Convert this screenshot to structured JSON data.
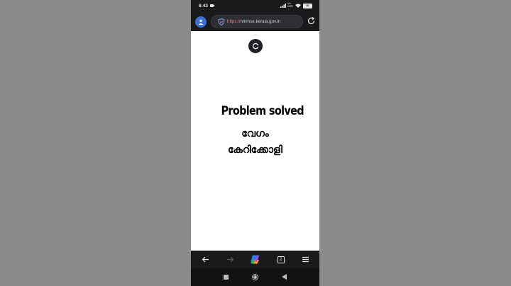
{
  "status_bar": {
    "time": "6:43",
    "network_label": "Vo\nWiFi",
    "battery": "82"
  },
  "browser": {
    "url_scheme": "https://",
    "url_host": "nmmse.kerala.gov.in",
    "tab_count": "2"
  },
  "page": {
    "headline": "Problem solved",
    "line2": "വേഗം",
    "line3": "കേറിക്കോളി"
  },
  "icons": {
    "profile": "person-icon",
    "security": "shield-icon",
    "reload": "reload-icon",
    "loading": "spinner-icon",
    "back": "arrow-left-icon",
    "forward": "arrow-right-icon",
    "copilot": "copilot-icon",
    "tabs": "tabs-icon",
    "menu": "hamburger-icon"
  },
  "colors": {
    "chrome_bg": "#1a1a1c",
    "avatar": "#3b6fd6",
    "scheme_text": "#ea7a8a",
    "page_bg": "#ffffff",
    "backdrop": "#8b8b8b"
  }
}
